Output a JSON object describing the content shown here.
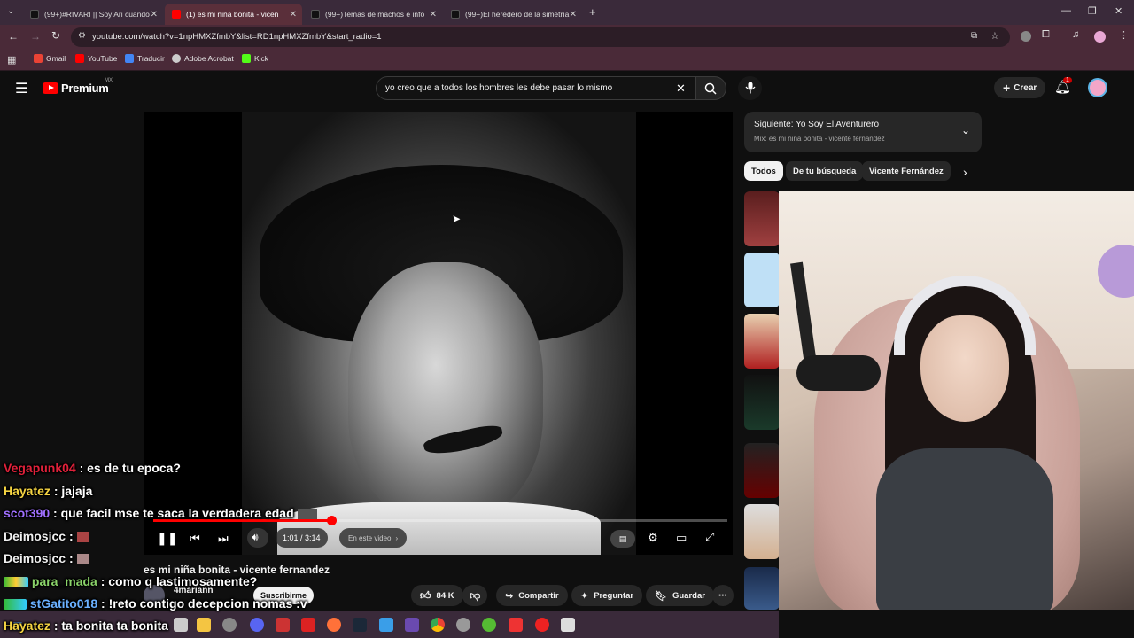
{
  "browser": {
    "tabs": [
      {
        "label": "(99+)#RIVARI || Soy Ari cuando",
        "color": "#111111"
      },
      {
        "label": "(1) es mi niña bonita - vicen",
        "color": "#ff0000",
        "active": true
      },
      {
        "label": "(99+)Temas de machos e info",
        "color": "#111111"
      },
      {
        "label": "(99+)El heredero de la simetría",
        "color": "#111111"
      }
    ],
    "new_tab": "+",
    "url": "youtube.com/watch?v=1npHMXZfmbY&list=RD1npHMXZfmbY&start_radio=1",
    "bookmarks": [
      {
        "label": "Gmail",
        "color": "#ea4335"
      },
      {
        "label": "YouTube",
        "color": "#ff0000"
      },
      {
        "label": "Traducir",
        "color": "#4285f4"
      },
      {
        "label": "Adobe Acrobat",
        "color": "#cccccc"
      },
      {
        "label": "Kick",
        "color": "#53fc18"
      }
    ]
  },
  "youtube": {
    "logo": "Premium",
    "region": "MX",
    "search_query": "yo creo que a todos los hombres les debe pasar lo mismo",
    "create_label": "Crear",
    "notif_count": "1"
  },
  "player": {
    "time": "1:01 / 3:14",
    "chapter_label": "En este video",
    "progress": 0.31
  },
  "upnext": {
    "title": "Siguiente: Yo Soy El Aventurero",
    "subtitle": "Mix: es mi niña bonita - vicente fernandez"
  },
  "chips": [
    "Todos",
    "De tu búsqueda",
    "Vicente Fernández"
  ],
  "video": {
    "title": "es mi niña bonita - vicente fernandez",
    "channel": "4mariann",
    "subscribe": "Suscribirme",
    "likes": "84 K",
    "share": "Compartir",
    "ask": "Preguntar",
    "save": "Guardar"
  },
  "chat": [
    {
      "user": "Vegapunk04",
      "msg": ": es de tu epoca?",
      "color": "#e0213a"
    },
    {
      "user": "Hayatez",
      "msg": ": jajaja",
      "color": "#f5d442"
    },
    {
      "user": "scot390",
      "msg": ": que facil mse te saca la verdadera edad",
      "color": "#a070ff"
    },
    {
      "user": "Deimosjcc",
      "msg": ":",
      "color": "#f0f0f0"
    },
    {
      "user": "Deimosjcc",
      "msg": ":",
      "color": "#f0f0f0"
    },
    {
      "user": "para_mada",
      "msg": ": como q lastimosamente?",
      "color": "#8bd46a"
    },
    {
      "user": "stGatito018",
      "msg": ": !reto contigo decepcion nomas :v",
      "color": "#6ab0ff"
    },
    {
      "user": "Hayatez",
      "msg": ": ta bonita ta bonita",
      "color": "#f5d442"
    }
  ],
  "icons": {
    "menu": "menu-icon",
    "search": "search-icon",
    "mic": "mic-icon",
    "bell": "bell-icon"
  }
}
